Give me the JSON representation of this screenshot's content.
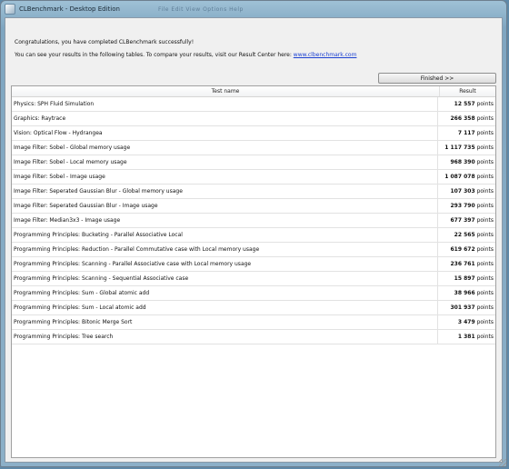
{
  "window": {
    "title": "CLBenchmark - Desktop Edition",
    "ghost_menu": "File   Edit   View   Options   Help"
  },
  "info": {
    "message_line1": "Congratulations, you have completed CLBenchmark successfully!",
    "message_line2_prefix": "You can see your results in the following tables. To compare your results, visit our Result Center here: ",
    "link_text": "www.clbenchmark.com",
    "finished_label": "Finished >>"
  },
  "table": {
    "col_name": "Test name",
    "col_result": "Result",
    "rows": [
      {
        "name": "Physics: SPH Fluid Simulation",
        "value": "12 557",
        "unit": "points"
      },
      {
        "name": "Graphics: Raytrace",
        "value": "266 358",
        "unit": "points"
      },
      {
        "name": "Vision: Optical Flow - Hydrangea",
        "value": "7 117",
        "unit": "points"
      },
      {
        "name": "Image Filter: Sobel - Global memory usage",
        "value": "1 117 735",
        "unit": "points"
      },
      {
        "name": "Image Filter: Sobel - Local memory usage",
        "value": "968 390",
        "unit": "points"
      },
      {
        "name": "Image Filter: Sobel - Image usage",
        "value": "1 087 078",
        "unit": "points"
      },
      {
        "name": "Image Filter: Seperated Gaussian Blur - Global memory usage",
        "value": "107 303",
        "unit": "points"
      },
      {
        "name": "Image Filter: Seperated Gaussian Blur - Image usage",
        "value": "293 790",
        "unit": "points"
      },
      {
        "name": "Image Filter: Median3x3 - Image usage",
        "value": "677 397",
        "unit": "points"
      },
      {
        "name": "Programming Principles: Bucketing - Parallel Associative Local",
        "value": "22 565",
        "unit": "points"
      },
      {
        "name": "Programming Principles: Reduction - Parallel Commutative case with Local memory usage",
        "value": "619 672",
        "unit": "points"
      },
      {
        "name": "Programming Principles: Scanning - Parallel Associative case with Local memory usage",
        "value": "236 761",
        "unit": "points"
      },
      {
        "name": "Programming Principles: Scanning - Sequential Associative case",
        "value": "15 897",
        "unit": "points"
      },
      {
        "name": "Programming Principles: Sum - Global atomic add",
        "value": "38 966",
        "unit": "points"
      },
      {
        "name": "Programming Principles: Sum - Local atomic add",
        "value": "301 937",
        "unit": "points"
      },
      {
        "name": "Programming Principles: Bitonic Merge Sort",
        "value": "3 479",
        "unit": "points"
      },
      {
        "name": "Programming Principles: Tree search",
        "value": "1 381",
        "unit": "points"
      }
    ]
  }
}
